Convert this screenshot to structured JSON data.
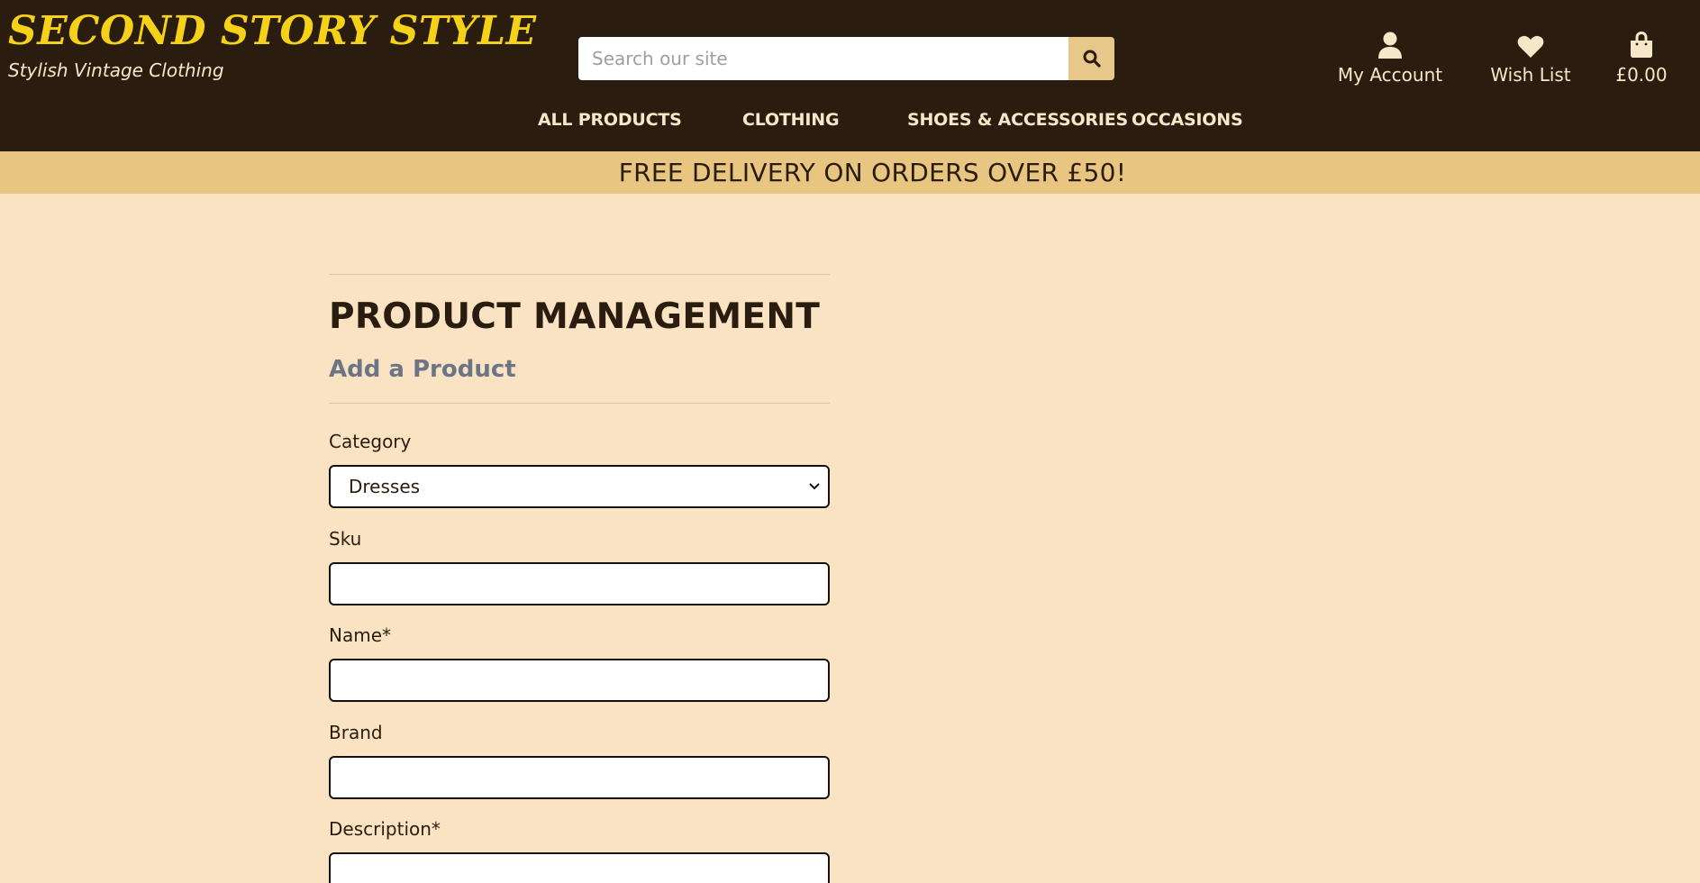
{
  "brand": {
    "title": "SECOND STORY STYLE",
    "tagline": "Stylish Vintage Clothing"
  },
  "search": {
    "placeholder": "Search our site",
    "button_icon": "search-icon"
  },
  "utility": {
    "account": {
      "label": "My Account",
      "icon": "user-icon"
    },
    "wishlist": {
      "label": "Wish List",
      "icon": "heart-icon"
    },
    "bag": {
      "label": "£0.00",
      "icon": "shopping-bag-icon"
    }
  },
  "nav": {
    "all_products": "ALL PRODUCTS",
    "clothing": "CLOTHING",
    "shoes_accessories": "SHOES & ACCESSORIES",
    "occasions": "OCCASIONS"
  },
  "banner": {
    "text": "FREE DELIVERY ON ORDERS OVER £50!"
  },
  "page": {
    "title": "PRODUCT MANAGEMENT",
    "subtitle": "Add a Product"
  },
  "form": {
    "category": {
      "label": "Category",
      "selected": "Dresses"
    },
    "sku": {
      "label": "Sku",
      "value": ""
    },
    "name": {
      "label": "Name*",
      "value": ""
    },
    "brand": {
      "label": "Brand",
      "value": ""
    },
    "description": {
      "label": "Description*",
      "value": ""
    }
  },
  "colors": {
    "header_bg": "#2a1d10",
    "brand_yellow": "#f5d218",
    "banner_bg": "#e8c682",
    "page_bg": "#fae3c2",
    "subtitle_gray": "#6b7585"
  }
}
